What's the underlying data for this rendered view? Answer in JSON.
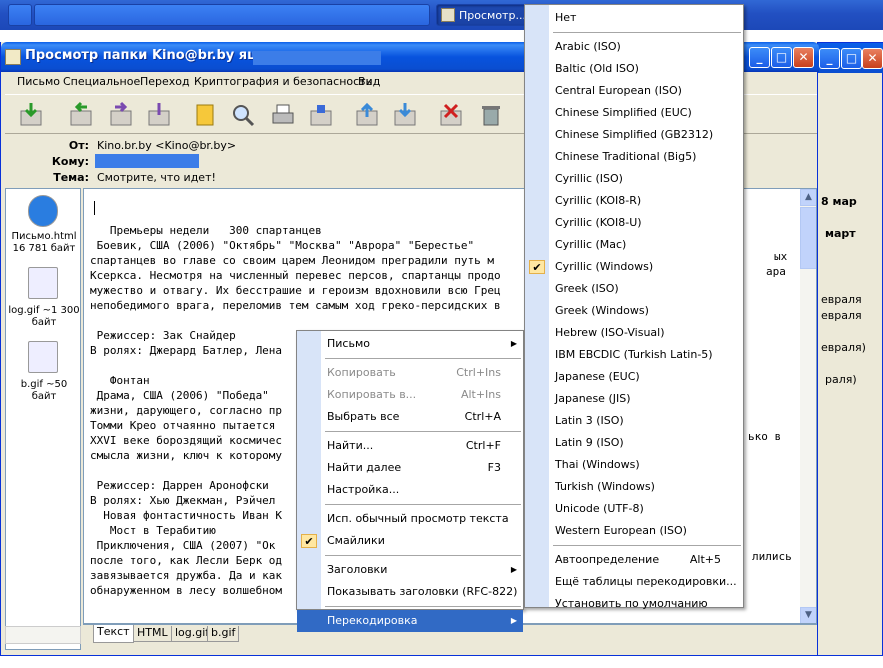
{
  "taskbar": {
    "item2": "Просмотр..."
  },
  "window": {
    "title": "Просмотр папки Kino@br.by ящика",
    "controls": {
      "min": "_",
      "max": "□",
      "close": "✕"
    }
  },
  "menubar": [
    "Письмо",
    "Специальное",
    "Переход",
    "Криптография и безопасность",
    "Вид"
  ],
  "header": {
    "from_label": "От:",
    "from_value": "Kino.br.by <Kino@br.by>",
    "to_label": "Кому:",
    "subject_label": "Тема:",
    "subject_value": "Смотрите, что идет!"
  },
  "attachments": [
    {
      "name": "Письмо.html",
      "size": "16 781 байт"
    },
    {
      "name": "log.gif ~1 300",
      "size": "байт"
    },
    {
      "name": "b.gif ~50",
      "size": "байт"
    }
  ],
  "body_lines": [
    "   Премьеры недели   300 спартанцев",
    " Боевик, США (2006) \"Октябрь\" \"Москва\" \"Аврора\" \"Берестье\"",
    "спартанцев во главе со своим царем Леонидом преградили путь м",
    "Ксеркса. Несмотря на численный перевес персов, спартанцы продо",
    "мужество и отвагу. Их бесстрашие и героизм вдохновили всю Грец",
    "непобедимого врага, переломив тем самым ход греко-персидских в",
    "",
    " Режиссер: Зак Снайдер",
    "В ролях: Джерард Батлер, Лена",
    "",
    "   Фонтан",
    " Драма, США (2006) \"Победа\"",
    "жизни, дарующего, согласно пр",
    "Томми Крео отчаянно пытается",
    "XXVI веке бороздящий космичес",
    "смысла жизни, ключ к которому",
    "",
    " Режиссер: Даррен Аронофски",
    "В ролях: Хью Джекман, Рэйчел",
    "  Новая фонтастичность Иван К",
    "   Мост в Терабитию",
    " Приключения, США (2007) \"Ок",
    "после того, как Лесли Берк од",
    "завязывается дружба. Да и как",
    "обнаруженном в лесу волшебном"
  ],
  "body_right_fragments": [
    "ых",
    "ара",
    "ько в",
    "лились"
  ],
  "bg_fragments": [
    "8 мар",
    "март",
    "евраля",
    "евраля",
    "евраля)",
    "раля)"
  ],
  "tabs": [
    "Текст",
    "HTML",
    "log.gif",
    "b.gif"
  ],
  "context_menu": [
    {
      "label": "Письмо",
      "shortcut": "",
      "submenu": true
    },
    {
      "sep": true
    },
    {
      "label": "Копировать",
      "shortcut": "Ctrl+Ins",
      "disabled": true
    },
    {
      "label": "Копировать в...",
      "shortcut": "Alt+Ins",
      "disabled": true
    },
    {
      "label": "Выбрать все",
      "shortcut": "Ctrl+A"
    },
    {
      "sep": true
    },
    {
      "label": "Найти...",
      "shortcut": "Ctrl+F"
    },
    {
      "label": "Найти далее",
      "shortcut": "F3"
    },
    {
      "label": "Настройка...",
      "shortcut": ""
    },
    {
      "sep": true
    },
    {
      "label": "Исп. обычный просмотр текста",
      "shortcut": ""
    },
    {
      "label": "Смайлики",
      "shortcut": "",
      "checked": true
    },
    {
      "sep": true
    },
    {
      "label": "Заголовки",
      "shortcut": "",
      "submenu": true
    },
    {
      "label": "Показывать заголовки (RFC-822)",
      "shortcut": ""
    },
    {
      "sep": true
    },
    {
      "label": "Перекодировка",
      "shortcut": "",
      "submenu": true,
      "highlighted": true
    }
  ],
  "encoding_menu": [
    {
      "label": "Нет"
    },
    {
      "sep": true
    },
    {
      "label": "Arabic (ISO)"
    },
    {
      "label": "Baltic (Old ISO)"
    },
    {
      "label": "Central European (ISO)"
    },
    {
      "label": "Chinese Simplified (EUC)"
    },
    {
      "label": "Chinese Simplified (GB2312)"
    },
    {
      "label": "Chinese Traditional (Big5)"
    },
    {
      "label": "Cyrillic (ISO)"
    },
    {
      "label": "Cyrillic (KOI8-R)"
    },
    {
      "label": "Cyrillic (KOI8-U)"
    },
    {
      "label": "Cyrillic (Mac)"
    },
    {
      "label": "Cyrillic (Windows)",
      "checked": true
    },
    {
      "label": "Greek (ISO)"
    },
    {
      "label": "Greek (Windows)"
    },
    {
      "label": "Hebrew (ISO-Visual)"
    },
    {
      "label": "IBM EBCDIC (Turkish Latin-5)"
    },
    {
      "label": "Japanese (EUC)"
    },
    {
      "label": "Japanese (JIS)"
    },
    {
      "label": "Latin 3 (ISO)"
    },
    {
      "label": "Latin 9 (ISO)"
    },
    {
      "label": "Thai (Windows)"
    },
    {
      "label": "Turkish (Windows)"
    },
    {
      "label": "Unicode (UTF-8)"
    },
    {
      "label": "Western European (ISO)"
    },
    {
      "sep": true
    },
    {
      "label": "Автоопределение",
      "shortcut": "Alt+5"
    },
    {
      "label": "Ещё таблицы перекодировки..."
    },
    {
      "label": "Установить по умолчанию"
    }
  ],
  "colors": {
    "accent": "#316ac5",
    "titlebar": "#0a4ed0",
    "menu_sidebar": "#d8e4f8"
  }
}
